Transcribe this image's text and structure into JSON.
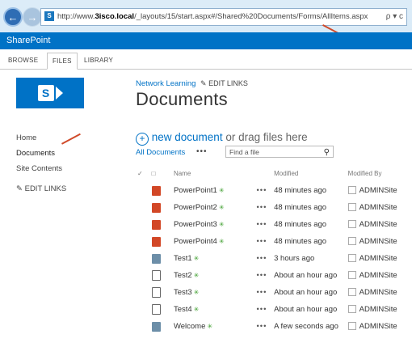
{
  "browser": {
    "url_prefix": "http://www.",
    "url_host": "3isco.local",
    "url_path": "/_layouts/15/start.aspx#/Shared%20Documents/Forms/AllItems.aspx",
    "url_icons": "ρ ▾ c"
  },
  "suite": {
    "title": "SharePoint"
  },
  "ribbon": {
    "tabs": [
      "BROWSE",
      "FILES",
      "LIBRARY"
    ],
    "active_tab": "FILES"
  },
  "site": {
    "title": "Network Learning",
    "edit_links": "EDIT LINKS"
  },
  "page": {
    "title": "Documents"
  },
  "leftnav": {
    "items": [
      "Home",
      "Documents",
      "Site Contents"
    ],
    "edit_links": "EDIT LINKS"
  },
  "library": {
    "new_document": "new document",
    "or_drag": "or drag files here",
    "view": "All Documents",
    "find_placeholder": "Find a file",
    "columns": {
      "name": "Name",
      "modified": "Modified",
      "modified_by": "Modified By"
    },
    "rows": [
      {
        "type": "ppt",
        "name": "PowerPoint1",
        "modified": "48 minutes ago",
        "by": "ADMINSite"
      },
      {
        "type": "ppt",
        "name": "PowerPoint2",
        "modified": "48 minutes ago",
        "by": "ADMINSite"
      },
      {
        "type": "ppt",
        "name": "PowerPoint3",
        "modified": "48 minutes ago",
        "by": "ADMINSite"
      },
      {
        "type": "ppt",
        "name": "PowerPoint4",
        "modified": "48 minutes ago",
        "by": "ADMINSite"
      },
      {
        "type": "img",
        "name": "Test1",
        "modified": "3 hours ago",
        "by": "ADMINSite"
      },
      {
        "type": "txt",
        "name": "Test2",
        "modified": "About an hour ago",
        "by": "ADMINSite"
      },
      {
        "type": "txt",
        "name": "Test3",
        "modified": "About an hour ago",
        "by": "ADMINSite"
      },
      {
        "type": "txt",
        "name": "Test4",
        "modified": "About an hour ago",
        "by": "ADMINSite"
      },
      {
        "type": "img",
        "name": "Welcome",
        "modified": "A few seconds ago",
        "by": "ADMINSite"
      }
    ]
  },
  "colors": {
    "accent": "#0072c6",
    "annotation_arrow": "#d04a2a",
    "powerpoint": "#d24726"
  }
}
